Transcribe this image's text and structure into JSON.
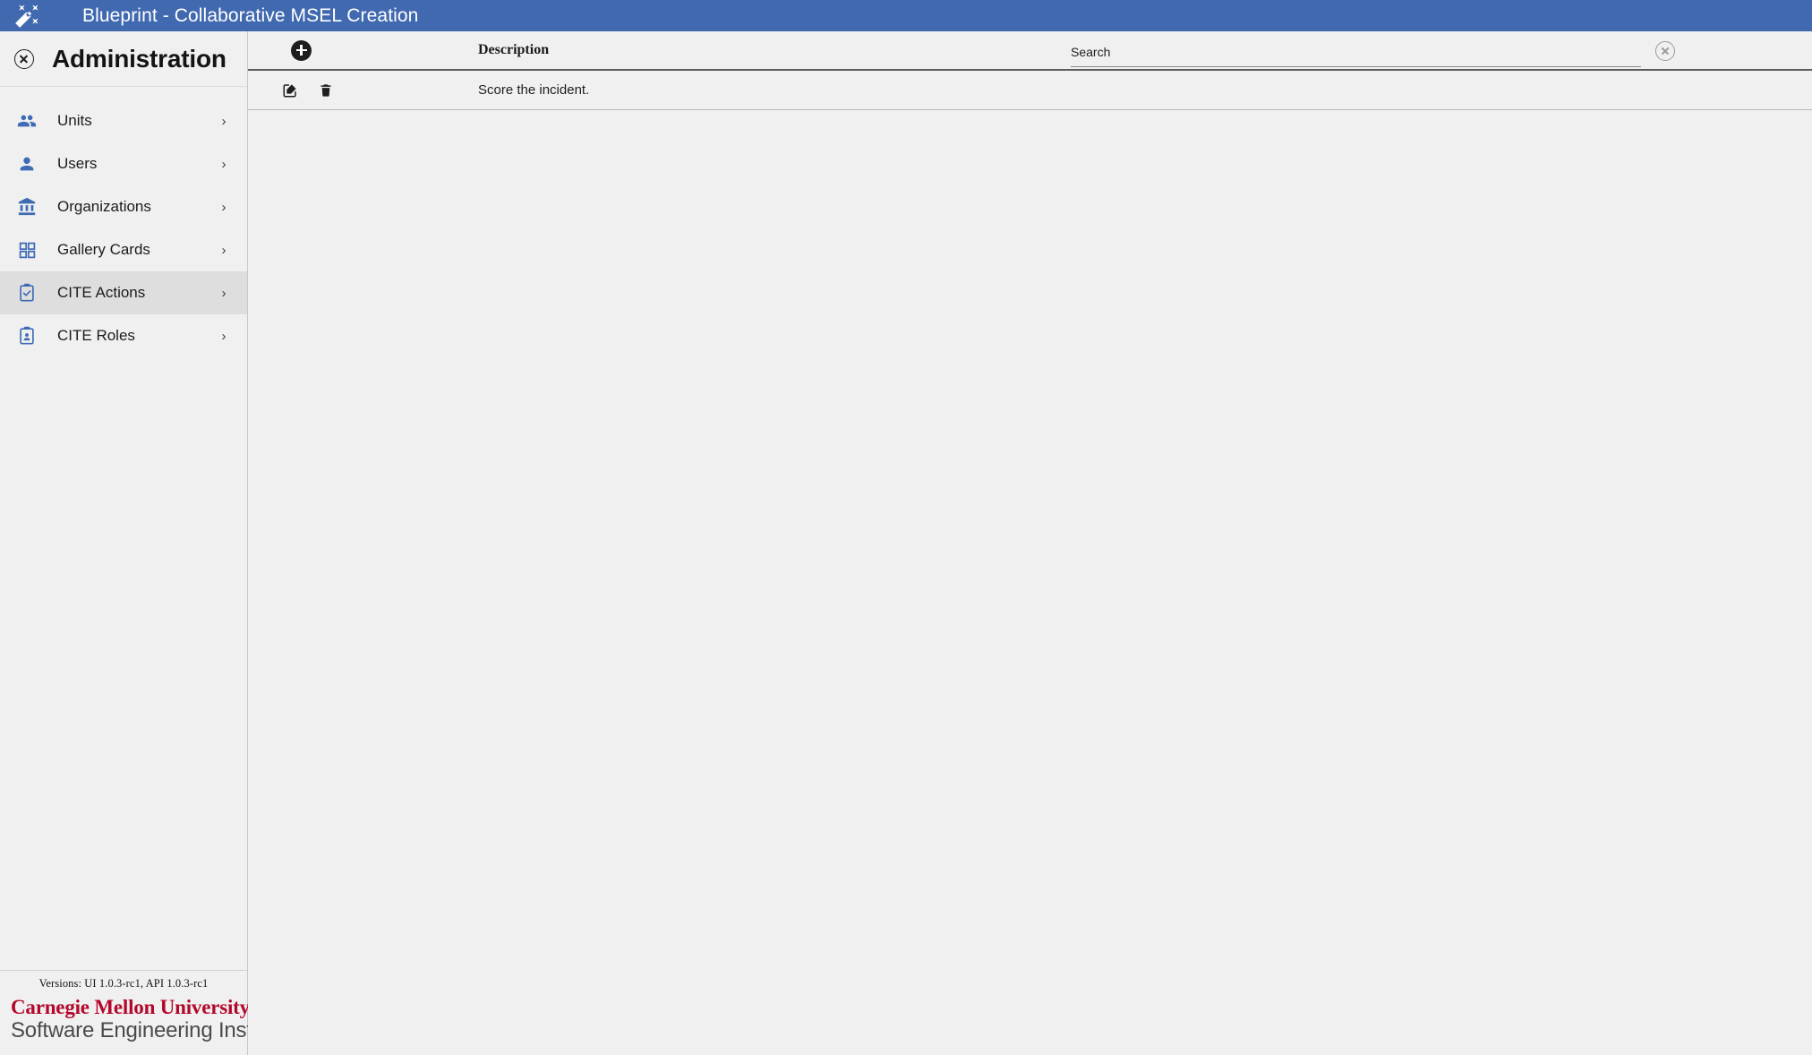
{
  "appbar": {
    "logo_icon": "auto-fix-wand-icon",
    "title": "Blueprint - Collaborative MSEL Creation",
    "background_color": "#4069b0",
    "text_color": "#ffffff"
  },
  "sidebar": {
    "close_icon": "close-circle-icon",
    "title": "Administration",
    "items": [
      {
        "label": "Units",
        "icon": "groups-icon",
        "chevron": "›",
        "selected": false
      },
      {
        "label": "Users",
        "icon": "person-icon",
        "chevron": "›",
        "selected": false
      },
      {
        "label": "Organizations",
        "icon": "account-balance-icon",
        "chevron": "›",
        "selected": false
      },
      {
        "label": "Gallery Cards",
        "icon": "dashboard-grid-icon",
        "chevron": "›",
        "selected": false
      },
      {
        "label": "CITE Actions",
        "icon": "clipboard-check-icon",
        "chevron": "›",
        "selected": true
      },
      {
        "label": "CITE Roles",
        "icon": "clipboard-person-icon",
        "chevron": "›",
        "selected": false
      }
    ],
    "footer": {
      "versions": "Versions: UI 1.0.3-rc1, API 1.0.3-rc1",
      "logo_line1": "Carnegie Mellon University",
      "logo_line2": "Software Engineering Institute",
      "logo_line1_color": "#b3082b",
      "logo_line2_color": "#4a4a4a"
    },
    "selected_background": "#dedede"
  },
  "main": {
    "toolbar": {
      "add_icon": "add-circle-icon",
      "add_label": ""
    },
    "table": {
      "columns": [
        {
          "key": "actions",
          "header": ""
        },
        {
          "key": "description",
          "header": "Description"
        }
      ],
      "rows": [
        {
          "edit_icon": "edit-square-icon",
          "delete_icon": "trash-icon",
          "description": "Score the incident."
        }
      ]
    },
    "search": {
      "placeholder": "Search",
      "value": "",
      "clear_icon": "clear-circle-icon"
    }
  }
}
